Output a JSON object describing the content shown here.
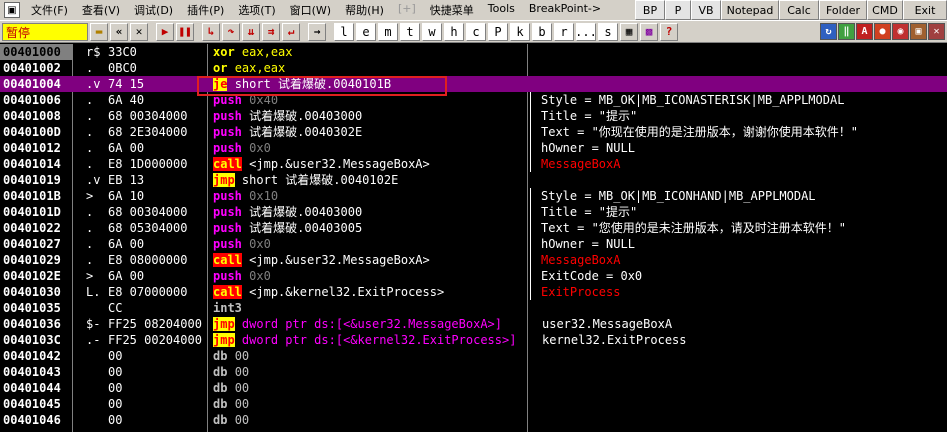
{
  "menubar": {
    "items": [
      {
        "label": "文件(F)",
        "dim": false
      },
      {
        "label": "查看(V)",
        "dim": false
      },
      {
        "label": "调试(D)",
        "dim": false
      },
      {
        "label": "插件(P)",
        "dim": false
      },
      {
        "label": "选项(T)",
        "dim": false
      },
      {
        "label": "窗口(W)",
        "dim": false
      },
      {
        "label": "帮助(H)",
        "dim": false
      },
      {
        "label": "[+]",
        "dim": true
      },
      {
        "label": "快捷菜单",
        "dim": false
      },
      {
        "label": "Tools",
        "dim": false
      },
      {
        "label": "BreakPoint->",
        "dim": false
      }
    ],
    "right_buttons": [
      "BP",
      "P",
      "VB",
      "Notepad",
      "Calc",
      "Folder",
      "CMD",
      "Exit"
    ]
  },
  "toolbar": {
    "status": "暂停",
    "letters": [
      "l",
      "e",
      "m",
      "t",
      "w",
      "h",
      "c",
      "P",
      "k",
      "b",
      "r",
      "...",
      "s"
    ]
  },
  "rows": [
    {
      "addr": "00401000",
      "mark": "r$",
      "hex": "33C0",
      "mn": "xor",
      "ops": "eax,eax",
      "cmt": ""
    },
    {
      "addr": "00401002",
      "mark": ".",
      "hex": "0BC0",
      "mn": "or",
      "ops": "eax,eax",
      "cmt": ""
    },
    {
      "addr": "00401004",
      "mark": ".v",
      "hex": "74 15",
      "mn": "je",
      "ops": "short 试着爆破.0040101B",
      "cmt": ""
    },
    {
      "addr": "00401006",
      "mark": ".",
      "hex": "6A 40",
      "mn": "push",
      "ops": "0x40",
      "cmt": "Style = MB_OK|MB_ICONASTERISK|MB_APPLMODAL"
    },
    {
      "addr": "00401008",
      "mark": ".",
      "hex": "68 00304000",
      "mn": "push",
      "ops": "试着爆破.00403000",
      "cmt": "Title = \"提示\""
    },
    {
      "addr": "0040100D",
      "mark": ".",
      "hex": "68 2E304000",
      "mn": "push",
      "ops": "试着爆破.0040302E",
      "cmt": "Text = \"你现在使用的是注册版本，谢谢你使用本软件！\""
    },
    {
      "addr": "00401012",
      "mark": ".",
      "hex": "6A 00",
      "mn": "push",
      "ops": "0x0",
      "cmt": "hOwner = NULL"
    },
    {
      "addr": "00401014",
      "mark": ".",
      "hex": "E8 1D000000",
      "mn": "call",
      "ops": "<jmp.&user32.MessageBoxA>",
      "cmt": "MessageBoxA"
    },
    {
      "addr": "00401019",
      "mark": ".v",
      "hex": "EB 13",
      "mn": "jmp",
      "ops": "short 试着爆破.0040102E",
      "cmt": ""
    },
    {
      "addr": "0040101B",
      "mark": ">",
      "hex": "6A 10",
      "mn": "push",
      "ops": "0x10",
      "cmt": "Style = MB_OK|MB_ICONHAND|MB_APPLMODAL"
    },
    {
      "addr": "0040101D",
      "mark": ".",
      "hex": "68 00304000",
      "mn": "push",
      "ops": "试着爆破.00403000",
      "cmt": "Title = \"提示\""
    },
    {
      "addr": "00401022",
      "mark": ".",
      "hex": "68 05304000",
      "mn": "push",
      "ops": "试着爆破.00403005",
      "cmt": "Text = \"您使用的是未注册版本，请及时注册本软件！\""
    },
    {
      "addr": "00401027",
      "mark": ".",
      "hex": "6A 00",
      "mn": "push",
      "ops": "0x0",
      "cmt": "hOwner = NULL"
    },
    {
      "addr": "00401029",
      "mark": ".",
      "hex": "E8 08000000",
      "mn": "call",
      "ops": "<jmp.&user32.MessageBoxA>",
      "cmt": "MessageBoxA"
    },
    {
      "addr": "0040102E",
      "mark": ">",
      "hex": "6A 00",
      "mn": "push",
      "ops": "0x0",
      "cmt": "ExitCode = 0x0"
    },
    {
      "addr": "00401030",
      "mark": "L.",
      "hex": "E8 07000000",
      "mn": "call",
      "ops": "<jmp.&kernel32.ExitProcess>",
      "cmt": "ExitProcess"
    },
    {
      "addr": "00401035",
      "mark": "",
      "hex": "CC",
      "mn": "int3",
      "ops": "",
      "cmt": ""
    },
    {
      "addr": "00401036",
      "mark": "$-",
      "hex": "FF25 08204000",
      "mn": "jmp",
      "ops": "dword ptr ds:[<&user32.MessageBoxA>]",
      "cmt": "user32.MessageBoxA"
    },
    {
      "addr": "0040103C",
      "mark": ".-",
      "hex": "FF25 00204000",
      "mn": "jmp",
      "ops": "dword ptr ds:[<&kernel32.ExitProcess>]",
      "cmt": "kernel32.ExitProcess"
    },
    {
      "addr": "00401042",
      "mark": "",
      "hex": "00",
      "mn": "db",
      "ops": "00",
      "cmt": ""
    },
    {
      "addr": "00401043",
      "mark": "",
      "hex": "00",
      "mn": "db",
      "ops": "00",
      "cmt": ""
    },
    {
      "addr": "00401044",
      "mark": "",
      "hex": "00",
      "mn": "db",
      "ops": "00",
      "cmt": ""
    },
    {
      "addr": "00401045",
      "mark": "",
      "hex": "00",
      "mn": "db",
      "ops": "00",
      "cmt": ""
    },
    {
      "addr": "00401046",
      "mark": "",
      "hex": "00",
      "mn": "db",
      "ops": "00",
      "cmt": ""
    }
  ],
  "colors": {
    "selected_row": "#800080",
    "status_bg": "#ffff00",
    "status_fg": "#c00000",
    "highlight_box": "#e02020"
  }
}
